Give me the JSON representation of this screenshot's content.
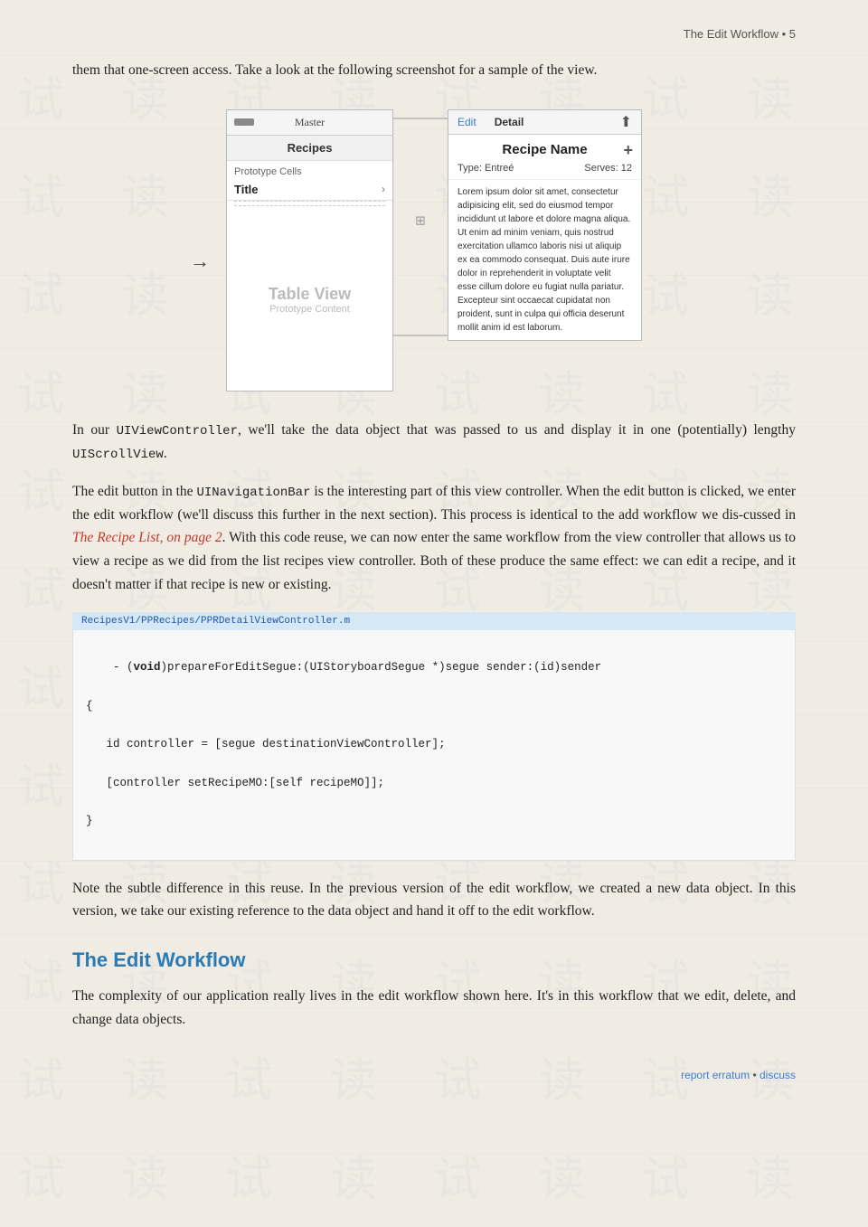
{
  "header": {
    "text": "The Edit Workflow • 5"
  },
  "intro_paragraph": "them that one-screen access. Take a look at the following screenshot for a sample of the view.",
  "diagram": {
    "master_title": "Master",
    "detail_title": "Detail",
    "recipes_label": "Recipes",
    "prototype_cells_label": "Prototype Cells",
    "title_label": "Title",
    "table_view_label": "Table View",
    "prototype_content_label": "Prototype Content",
    "edit_tab": "Edit",
    "detail_tab": "Detail",
    "recipe_name": "Recipe Name",
    "type_label": "Type: Entreé",
    "serves_label": "Serves: 12",
    "recipe_body": "Lorem ipsum dolor sit amet, consectetur adipisicing elit, sed do eiusmod tempor incididunt ut labore et dolore magna aliqua. Ut enim ad minim veniam, quis nostrud exercitation ullamco laboris nisi ut aliquip ex ea commodo consequat. Duis aute irure dolor in reprehenderit in voluptate velit esse cillum dolore eu fugiat nulla pariatur. Excepteur sint occaecat cupidatat non proident, sunt in culpa qui officia deserunt mollit anim id est laborum."
  },
  "paragraph1": {
    "before_code1": "In our ",
    "code1": "UIViewController",
    "middle1": ", we'll take the data object that was passed to us and display it in one (potentially) lengthy ",
    "code2": "UIScrollView",
    "after": "."
  },
  "paragraph2": {
    "text1": "The edit button in the ",
    "code1": "UINavigationBar",
    "text2": " is the interesting part of this view controller. When the edit button is clicked, we enter the edit workflow (we'll discuss this further in the next section). This process is identical to the add workflow we dis-cussed in ",
    "link_text": "The Recipe List, on page 2",
    "text3": ". With this code reuse, we can now enter the same workflow from the view controller that allows us to view a recipe as we did from the list recipes view controller. Both of these produce the same effect: we can edit a recipe, and it doesn't matter if that recipe is new or existing."
  },
  "code_filename": "RecipesV1/PPRecipes/PPRDetailViewController.m",
  "code_lines": [
    "- (void)prepareForEditSegue:(UIStoryboardSegue *)segue sender:(id)sender",
    "{",
    "   id controller = [segue destinationViewController];",
    "   [controller setRecipeMO:[self recipeMO]];",
    "}"
  ],
  "paragraph3": "Note the subtle difference in this reuse. In the previous version of the edit workflow, we created a new data object. In this version, we take our existing reference to the data object and hand it off to the edit workflow.",
  "section_heading": "The Edit Workflow",
  "paragraph4": "The complexity of our application really lives in the edit workflow shown here. It's in this workflow that we edit, delete, and change data objects.",
  "footer": {
    "link1": "report erratum",
    "dot": " • ",
    "link2": "discuss"
  }
}
